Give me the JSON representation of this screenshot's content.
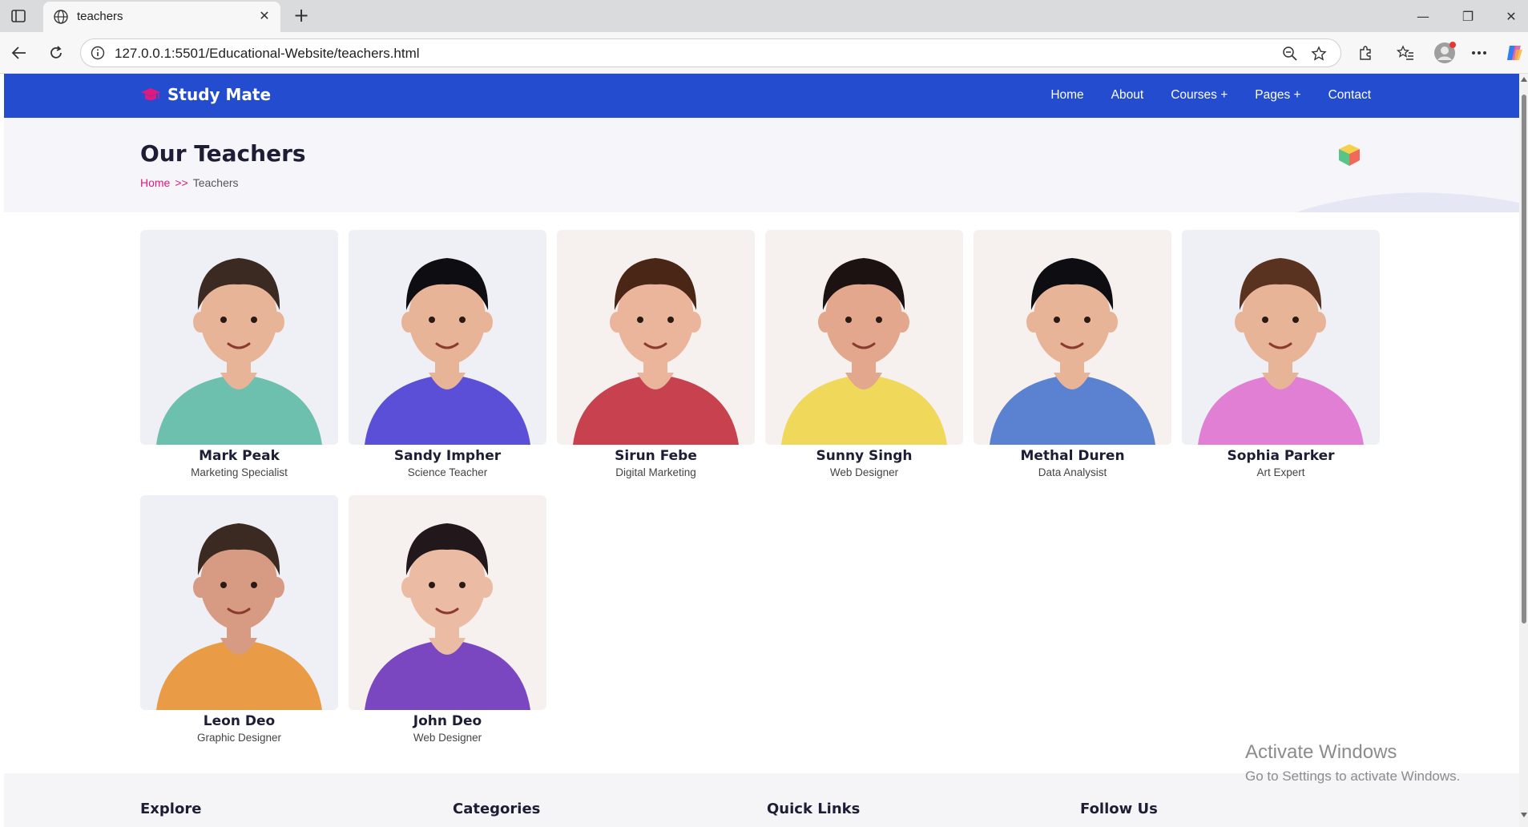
{
  "browser": {
    "tab_title": "teachers",
    "url": "127.0.0.1:5501/Educational-Website/teachers.html"
  },
  "site": {
    "brand": "Study Mate",
    "nav": [
      "Home",
      "About",
      "Courses +",
      "Pages +",
      "Contact"
    ]
  },
  "hero": {
    "title": "Our Teachers",
    "breadcrumb_home": "Home",
    "breadcrumb_sep": ">>",
    "breadcrumb_current": "Teachers"
  },
  "teachers": [
    {
      "name": "Mark Peak",
      "role": "Marketing Specialist",
      "bg": "#efeff6",
      "shirt": "#6dbfae",
      "hair": "#3a2a22",
      "skin": "#e8b498"
    },
    {
      "name": "Sandy Impher",
      "role": "Science Teacher",
      "bg": "#efeff6",
      "shirt": "#5a4fd6",
      "hair": "#0e0e12",
      "skin": "#e8b498"
    },
    {
      "name": "Sirun Febe",
      "role": "Digital Marketing",
      "bg": "#f6f1ee",
      "shirt": "#c8414f",
      "hair": "#4a2616",
      "skin": "#ebb59b"
    },
    {
      "name": "Sunny Singh",
      "role": "Web Designer",
      "bg": "#f6f1ee",
      "shirt": "#f0d85a",
      "hair": "#1c1212",
      "skin": "#e2a78d"
    },
    {
      "name": "Methal Duren",
      "role": "Data Analysist",
      "bg": "#f6f1ee",
      "shirt": "#5b82d0",
      "hair": "#0e0e12",
      "skin": "#e8b498"
    },
    {
      "name": "Sophia Parker",
      "role": "Art Expert",
      "bg": "#efeff6",
      "shirt": "#e07fd3",
      "hair": "#5a3220",
      "skin": "#e8b498"
    },
    {
      "name": "Leon Deo",
      "role": "Graphic Designer",
      "bg": "#efeff6",
      "shirt": "#e99c45",
      "hair": "#3a2a22",
      "skin": "#d79a83"
    },
    {
      "name": "John Deo",
      "role": "Web Designer",
      "bg": "#f6f1ee",
      "shirt": "#7b47c1",
      "hair": "#22171a",
      "skin": "#ecbba3"
    }
  ],
  "footer": {
    "columns": [
      "Explore",
      "Categories",
      "Quick Links",
      "Follow Us"
    ]
  },
  "watermark": {
    "line1": "Activate Windows",
    "line2": "Go to Settings to activate Windows."
  },
  "colors": {
    "navbar": "#234ccf",
    "accent": "#e0197d"
  }
}
